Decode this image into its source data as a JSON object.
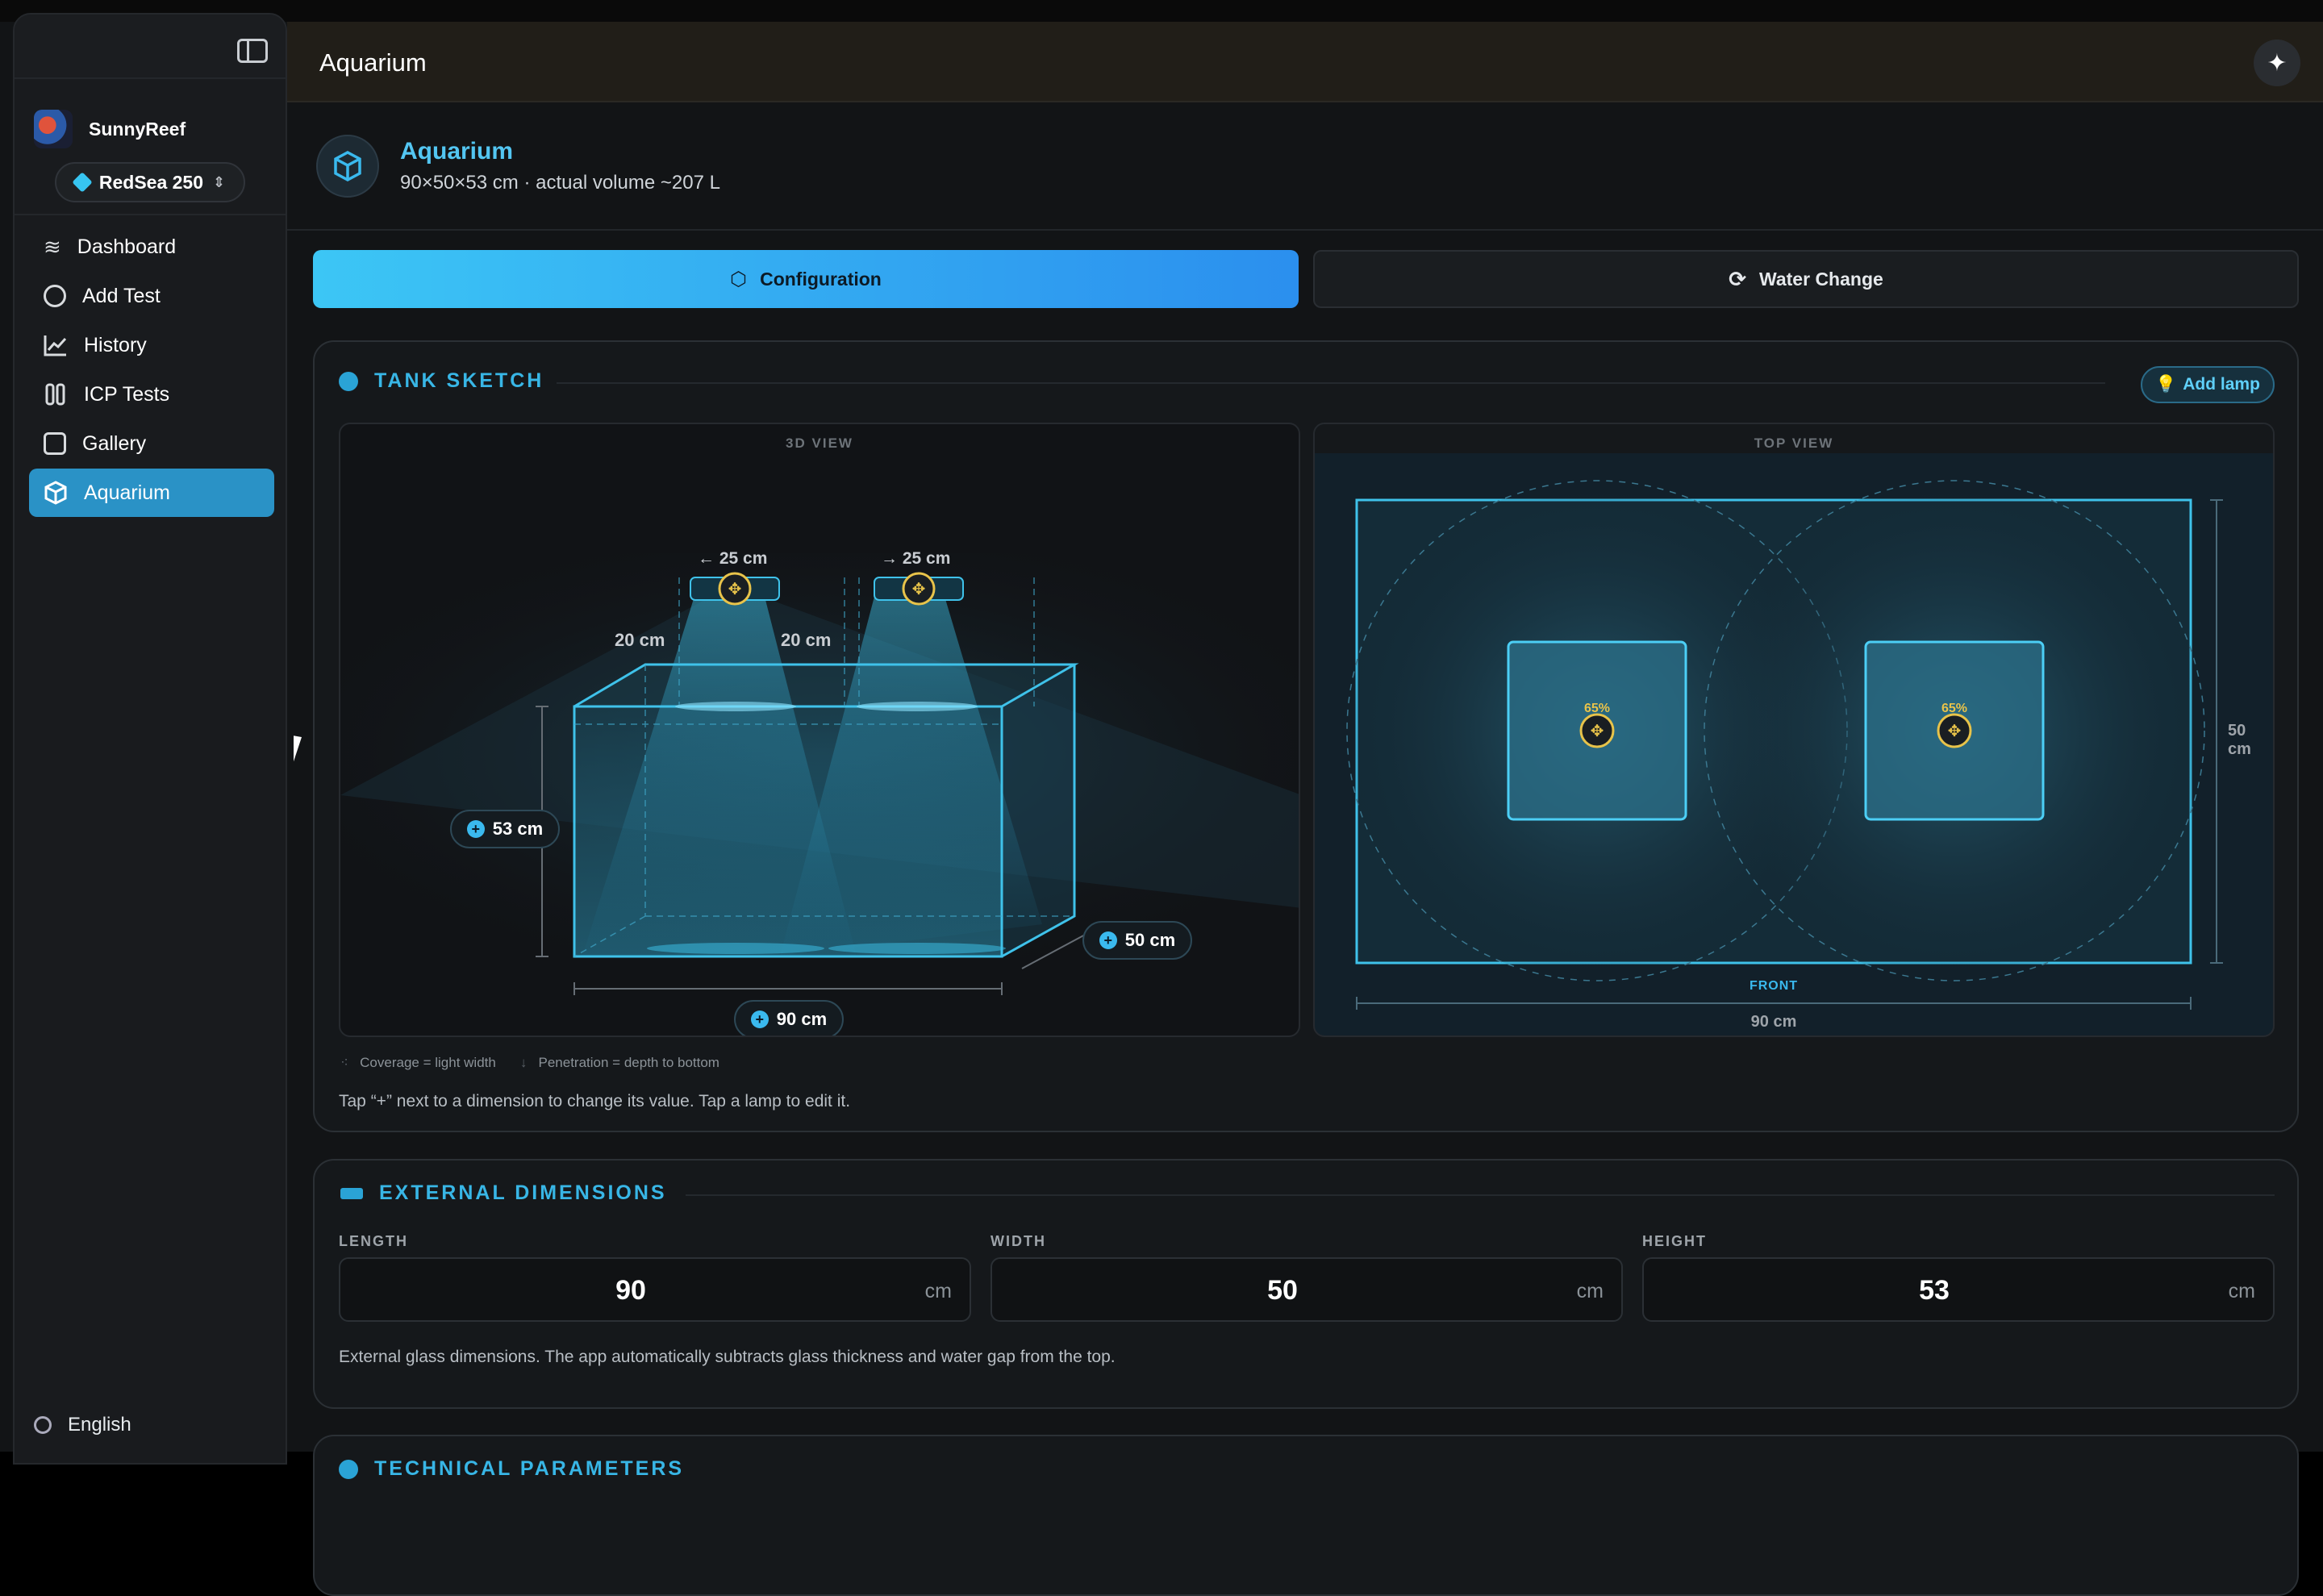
{
  "app": {
    "title": "Aquarium"
  },
  "sidebar": {
    "user": "SunnyReef",
    "tank": "RedSea 250",
    "items": [
      {
        "label": "Dashboard",
        "icon": "waves-icon"
      },
      {
        "label": "Add Test",
        "icon": "plus-circle-icon"
      },
      {
        "label": "History",
        "icon": "chart-line-icon"
      },
      {
        "label": "ICP Tests",
        "icon": "test-tubes-icon"
      },
      {
        "label": "Gallery",
        "icon": "images-icon"
      },
      {
        "label": "Aquarium",
        "icon": "cube-icon",
        "active": true
      }
    ],
    "language": "English"
  },
  "tank": {
    "name": "Aquarium",
    "subtitle": "90×50×53 cm · actual volume ~207 L"
  },
  "tabs": {
    "config": "Configuration",
    "water": "Water Change"
  },
  "sketch": {
    "title": "TANK SKETCH",
    "add_lamp": "Add lamp",
    "view3d": "3D VIEW",
    "viewtop": "TOP VIEW",
    "lamp1_offset": "← 25 cm",
    "lamp2_offset": "→ 25 cm",
    "lamp1_height": "20 cm",
    "lamp2_height": "20 cm",
    "height_badge": "53 cm",
    "width_badge": "50 cm",
    "length_badge": "90 cm",
    "lamp1_pct": "65%",
    "lamp2_pct": "65%",
    "front": "FRONT",
    "top_length": "90 cm",
    "top_width": "50 cm",
    "legend_coverage": "Coverage = light width",
    "legend_penetration": "Penetration = depth to bottom",
    "hint": "Tap “+” next to a dimension to change its value. Tap a lamp to edit it."
  },
  "dims": {
    "title": "EXTERNAL DIMENSIONS",
    "length_label": "LENGTH",
    "length": "90",
    "width_label": "WIDTH",
    "width": "50",
    "height_label": "HEIGHT",
    "height": "53",
    "unit": "cm",
    "note": "External glass dimensions. The app automatically subtracts glass thickness and water gap from the top."
  },
  "tech": {
    "title": "TECHNICAL PARAMETERS"
  },
  "colors": {
    "accent": "#38b6e6",
    "active_nav": "#2a92c6",
    "lamp": "#e8c34a"
  }
}
